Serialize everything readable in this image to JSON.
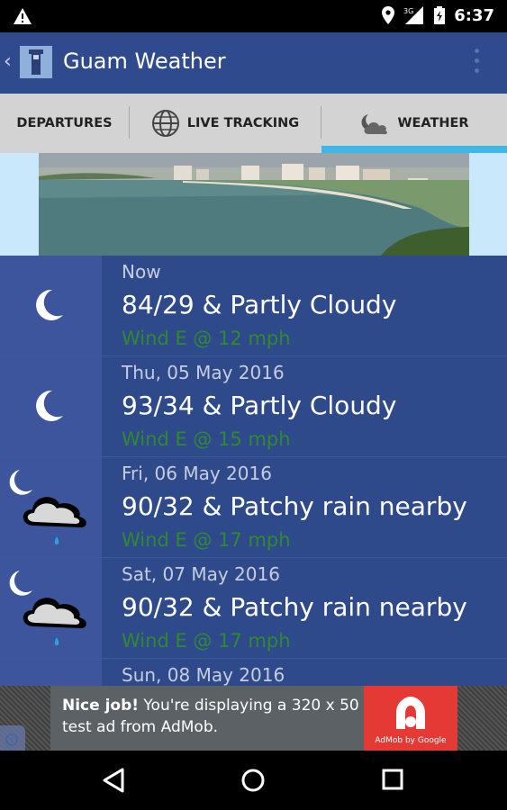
{
  "status_bar": {
    "time": "6:37",
    "icons": [
      "warning-icon",
      "location-icon",
      "signal-3g-icon",
      "battery-icon"
    ]
  },
  "app_bar": {
    "title": "Guam Weather"
  },
  "tabs": [
    {
      "label": "DEPARTURES",
      "icon": ""
    },
    {
      "label": "LIVE TRACKING",
      "icon": "globe-icon"
    },
    {
      "label": "WEATHER",
      "icon": "cloud-moon-icon",
      "selected": true
    }
  ],
  "forecast": [
    {
      "date": "Now",
      "summary": "84/29 & Partly Cloudy",
      "wind": "Wind E @ 12 mph",
      "icon": "moon-icon"
    },
    {
      "date": "Thu, 05 May 2016",
      "summary": "93/34 & Partly Cloudy",
      "wind": "Wind E @ 15 mph",
      "icon": "moon-icon"
    },
    {
      "date": "Fri, 06 May 2016",
      "summary": "90/32 & Patchy rain nearby",
      "wind": "Wind E @ 17 mph",
      "icon": "moon-cloud-rain-icon"
    },
    {
      "date": "Sat, 07 May 2016",
      "summary": "90/32 & Patchy rain nearby",
      "wind": "Wind E @ 17 mph",
      "icon": "moon-cloud-rain-icon"
    },
    {
      "date": "Sun, 08 May 2016",
      "summary": "",
      "wind": "",
      "icon": ""
    }
  ],
  "ad": {
    "headline": "Nice job!",
    "body": "You're displaying a 320 x 50 test ad from AdMob.",
    "logo_caption": "AdMob by Google"
  },
  "colors": {
    "app_bar": "#2f4b8e",
    "list_bg": "#2f4a8a",
    "wind_text": "#2f8a2f",
    "tab_indicator": "#3fb7e6"
  }
}
